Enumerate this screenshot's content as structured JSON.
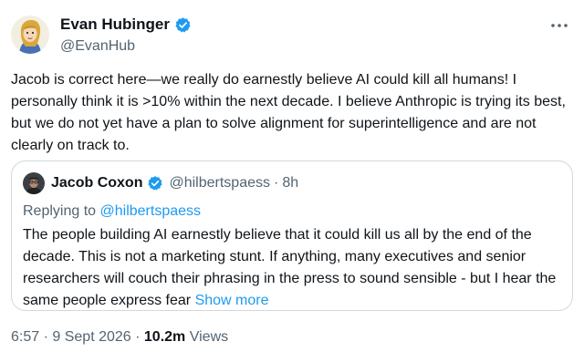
{
  "author": {
    "display_name": "Evan Hubinger",
    "handle": "@EvanHub",
    "verified_icon": "verified-badge-icon",
    "avatar": "cartoon-avatar"
  },
  "tweet": {
    "text": "Jacob is correct here—we really do earnestly believe AI could kill all humans! I personally think it is >10% within the next decade. I believe Anthropic is trying its best, but we do not yet have a plan to solve alignment for superintelligence and are not clearly on track to."
  },
  "quoted": {
    "display_name": "Jacob Coxon",
    "handle": "@hilbertspaess",
    "separator": "·",
    "time": "8h",
    "replying_prefix": "Replying to",
    "replying_handle": "@hilbertspaess",
    "text": "The people building AI earnestly believe that it could kill us all by the end of the decade. This is not a marketing stunt. If anything, many executives and senior researchers will couch their phrasing in the press to sound sensible - but I hear the same people express fear",
    "show_more": "Show more"
  },
  "meta": {
    "time": "6:57",
    "sep1": "·",
    "date": "9 Sept 2026",
    "sep2": "·",
    "views_count": "10.2m",
    "views_label": "Views"
  },
  "colors": {
    "accent": "#1d9bf0",
    "secondary_text": "#536471",
    "border": "#cfd9de"
  }
}
